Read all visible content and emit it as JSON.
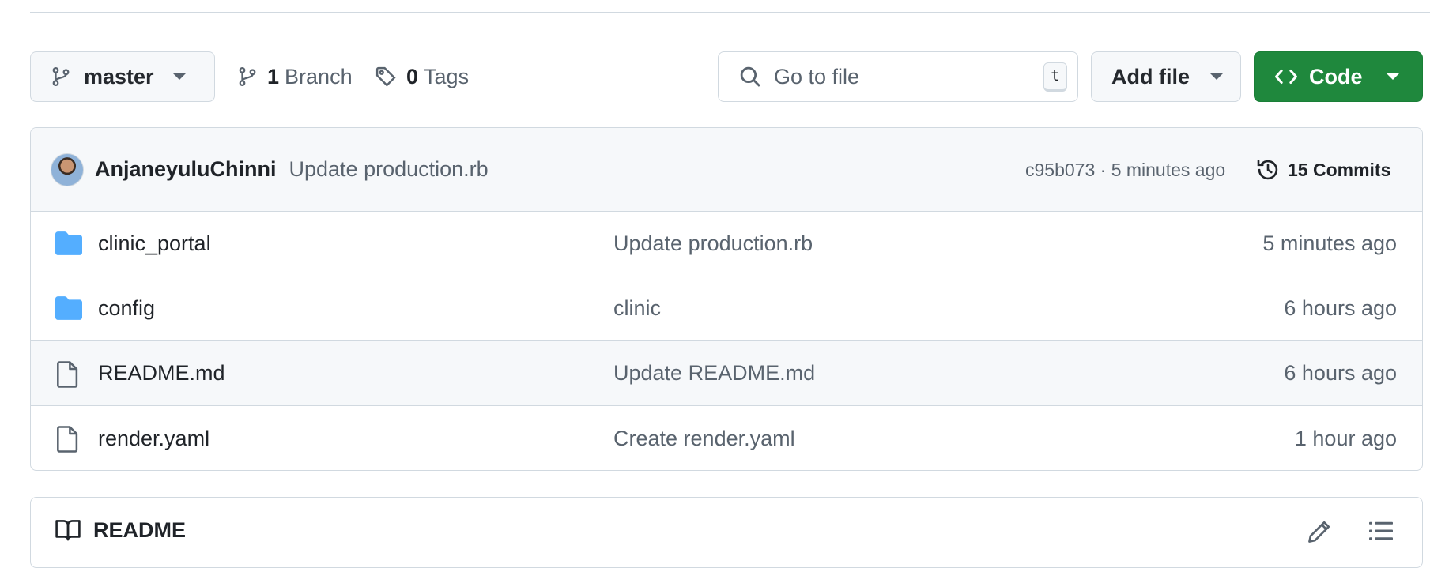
{
  "toolbar": {
    "branch_name": "master",
    "branch_count": "1",
    "branch_label": "Branch",
    "tag_count": "0",
    "tag_label": "Tags",
    "search_placeholder": "Go to file",
    "search_shortcut": "t",
    "add_file_label": "Add file",
    "code_label": "Code"
  },
  "latest_commit": {
    "author": "AnjaneyuluChinni",
    "message": "Update production.rb",
    "meta": "c95b073 · 5 minutes ago",
    "commits_label": "15 Commits"
  },
  "files": [
    {
      "name": "clinic_portal",
      "type": "folder",
      "commit": "Update production.rb",
      "age": "5 minutes ago"
    },
    {
      "name": "config",
      "type": "folder",
      "commit": "clinic",
      "age": "6 hours ago"
    },
    {
      "name": "README.md",
      "type": "file",
      "commit": "Update README.md",
      "age": "6 hours ago"
    },
    {
      "name": "render.yaml",
      "type": "file",
      "commit": "Create render.yaml",
      "age": "1 hour ago"
    }
  ],
  "readme": {
    "title": "README"
  },
  "colors": {
    "accent_green": "#1f883d",
    "folder_blue": "#54aeff",
    "border": "#d1d9e0"
  }
}
